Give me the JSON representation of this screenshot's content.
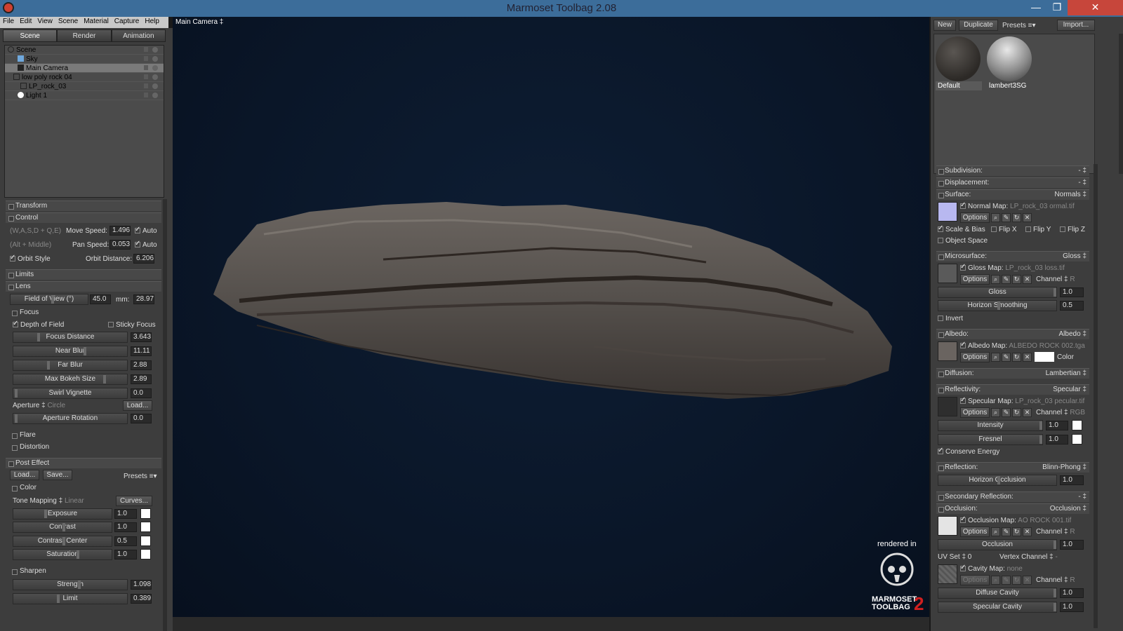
{
  "window": {
    "title": "Marmoset Toolbag 2.08"
  },
  "menu": [
    "File",
    "Edit",
    "View",
    "Scene",
    "Material",
    "Capture",
    "Help"
  ],
  "tabs": [
    "Scene",
    "Render",
    "Animation"
  ],
  "tree": [
    "Scene",
    "Sky",
    "Main Camera",
    "low poly rock 04",
    "LP_rock_03",
    "Light 1"
  ],
  "left": {
    "transform": "Transform",
    "control": "Control",
    "keys1": "(W,A,S,D + Q,E)",
    "move_speed_label": "Move Speed:",
    "move_speed": "1.496",
    "auto": "Auto",
    "keys2": "(Alt + Middle)",
    "pan_speed_label": "Pan Speed:",
    "pan_speed": "0.053",
    "orbit_style": "Orbit Style",
    "orbit_distance_label": "Orbit Distance:",
    "orbit_distance": "6.206",
    "limits": "Limits",
    "lens": "Lens",
    "fov_label": "Field of View (°)",
    "fov": "45.0",
    "mm_label": "mm:",
    "mm": "28.97",
    "focus": "Focus",
    "dof": "Depth of Field",
    "sticky": "Sticky Focus",
    "focus_distance": "Focus Distance",
    "focus_distance_val": "3.643",
    "near_blur": "Near Blur",
    "near_blur_val": "11.11",
    "far_blur": "Far Blur",
    "far_blur_val": "2.88",
    "bokeh": "Max Bokeh Size",
    "bokeh_val": "2.89",
    "swirl": "Swirl Vignette",
    "swirl_val": "0.0",
    "aperture": "Aperture ‡",
    "aperture_val": "Circle",
    "load": "Load...",
    "ap_rot": "Aperture Rotation",
    "ap_rot_val": "0.0",
    "flare": "Flare",
    "distortion": "Distortion",
    "post": "Post Effect",
    "save": "Save...",
    "presets": "Presets ≡▾",
    "color": "Color",
    "tone": "Tone Mapping ‡",
    "tone_val": "Linear",
    "curves": "Curves...",
    "exposure": "Exposure",
    "exposure_val": "1.0",
    "contrast": "Contrast",
    "contrast_val": "1.0",
    "contrast_center": "Contrast Center",
    "contrast_center_val": "0.5",
    "saturation": "Saturation",
    "saturation_val": "1.0",
    "sharpen": "Sharpen",
    "strength": "Strength",
    "strength_val": "1.098",
    "limit": "Limit",
    "limit_val": "0.389"
  },
  "viewport": {
    "camera": "Main Camera ‡",
    "watermark_top": "rendered in",
    "watermark_logo": "MARMOSET TOOLBAG"
  },
  "right": {
    "new": "New",
    "duplicate": "Duplicate",
    "presets": "Presets ≡▾",
    "import": "Import...",
    "materials": [
      "Default",
      "lambert3SG"
    ],
    "subdivision": "Subdivision:",
    "displacement": "Displacement:",
    "dash": "- ‡",
    "surface": "Surface:",
    "surface_val": "Normals ‡",
    "normal_map": "Normal Map:",
    "normal_map_file": "LP_rock_03 ormal.tif",
    "options": "Options",
    "scale_bias": "Scale & Bias",
    "flipx": "Flip X",
    "flipy": "Flip Y",
    "flipz": "Flip Z",
    "object_space": "Object Space",
    "micro": "Microsurface:",
    "micro_val": "Gloss ‡",
    "gloss_map": "Gloss Map:",
    "gloss_map_file": "LP_rock_03 loss.tif",
    "channel": "Channel ‡",
    "channel_r": "R",
    "gloss": "Gloss",
    "gloss_val": "1.0",
    "horizon_smoothing": "Horizon Smoothing",
    "horizon_smoothing_val": "0.5",
    "invert": "Invert",
    "albedo": "Albedo:",
    "albedo_val": "Albedo ‡",
    "albedo_map": "Albedo Map:",
    "albedo_map_file": "ALBEDO ROCK 002.tga",
    "color": "Color",
    "diffusion": "Diffusion:",
    "diffusion_val": "Lambertian ‡",
    "reflectivity": "Reflectivity:",
    "reflectivity_val": "Specular ‡",
    "spec_map": "Specular Map:",
    "spec_map_file": "LP_rock_03 pecular.tif",
    "channel_rgb": "RGB",
    "intensity": "Intensity",
    "intensity_val": "1.0",
    "fresnel": "Fresnel",
    "fresnel_val": "1.0",
    "conserve": "Conserve Energy",
    "reflection": "Reflection:",
    "reflection_val": "Blinn-Phong ‡",
    "horizon_occ": "Horizon Occlusion",
    "horizon_occ_val": "1.0",
    "secondary": "Secondary Reflection:",
    "occlusion": "Occlusion:",
    "occlusion_val": "Occlusion ‡",
    "occ_map": "Occlusion Map:",
    "occ_map_file": "AO ROCK 001.tif",
    "occ": "Occlusion",
    "occ_v": "1.0",
    "uvset": "UV Set ‡ 0",
    "vertex_channel": "Vertex Channel ‡",
    "dash2": "-",
    "cavity_map": "Cavity Map:",
    "cavity_map_file": "none",
    "diffuse_cavity": "Diffuse Cavity",
    "diffuse_cavity_val": "1.0",
    "specular_cavity": "Specular Cavity",
    "specular_cavity_val": "1.0"
  }
}
